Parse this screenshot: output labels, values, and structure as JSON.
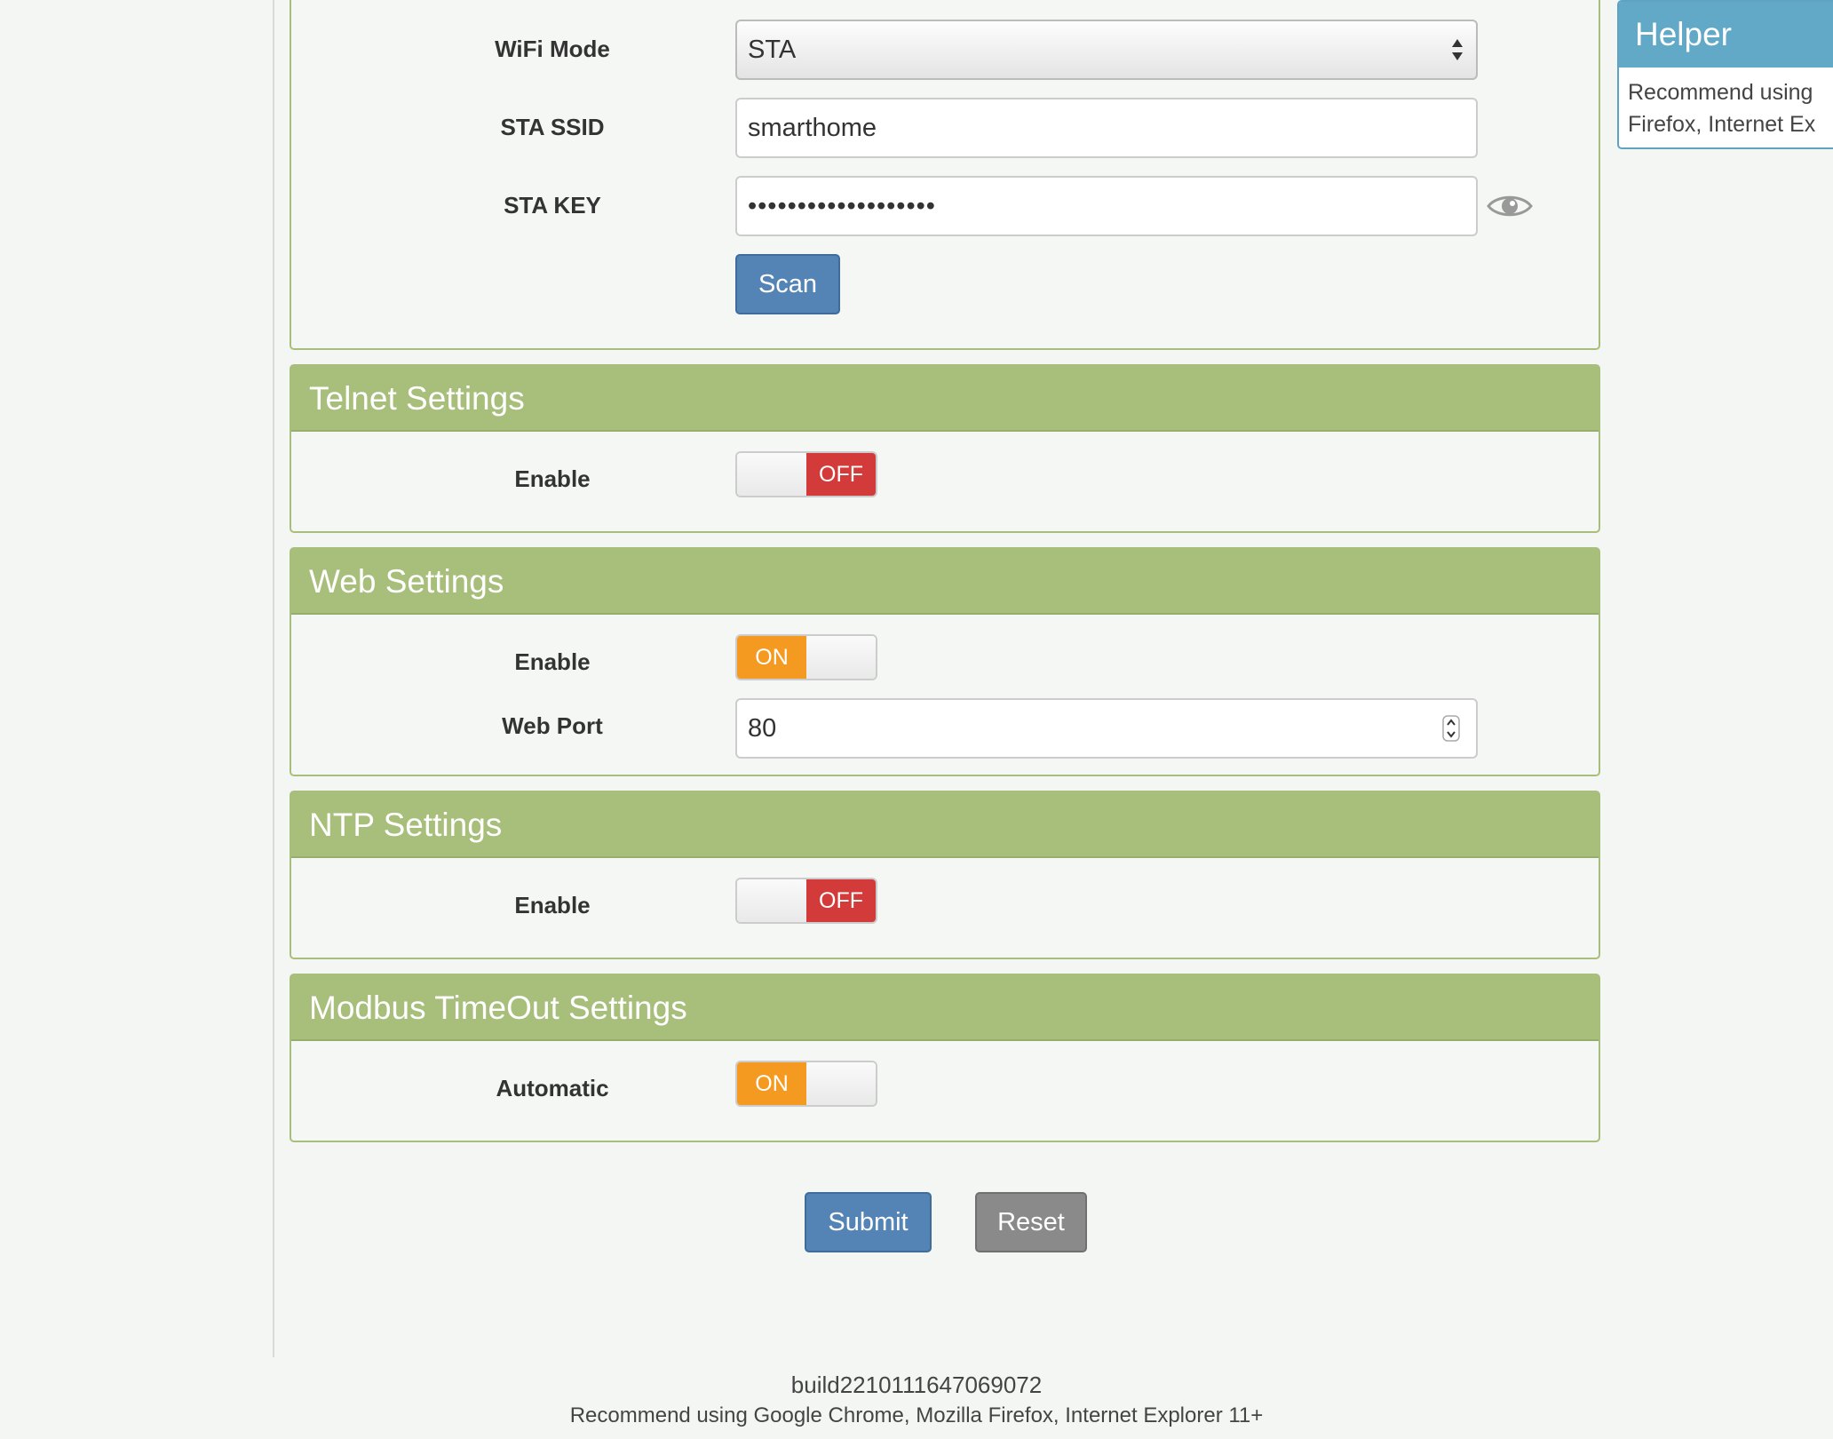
{
  "wifi": {
    "mode_label": "WiFi Mode",
    "mode_value": "STA",
    "ssid_label": "STA SSID",
    "ssid_value": "smarthome",
    "key_label": "STA KEY",
    "key_value": "•••••••••••••••••••",
    "scan_label": "Scan"
  },
  "telnet": {
    "title": "Telnet Settings",
    "enable_label": "Enable",
    "enable_state": "OFF"
  },
  "web": {
    "title": "Web Settings",
    "enable_label": "Enable",
    "enable_state": "ON",
    "port_label": "Web Port",
    "port_value": "80"
  },
  "ntp": {
    "title": "NTP Settings",
    "enable_label": "Enable",
    "enable_state": "OFF"
  },
  "modbus": {
    "title": "Modbus TimeOut Settings",
    "automatic_label": "Automatic",
    "automatic_state": "ON"
  },
  "actions": {
    "submit_label": "Submit",
    "reset_label": "Reset"
  },
  "helper": {
    "title": "Helper",
    "line1": "Recommend using",
    "line2": "Firefox, Internet Ex"
  },
  "footer": {
    "build": "build2210111647069072",
    "recommend": "Recommend using Google Chrome, Mozilla Firefox, Internet Explorer 11+"
  },
  "colors": {
    "panel_header": "#a8be7b",
    "helper_header": "#62a9c7",
    "toggle_on": "#f59a20",
    "toggle_off": "#d33b3b",
    "button_primary": "#5384b5",
    "button_secondary": "#8a8a8a"
  }
}
